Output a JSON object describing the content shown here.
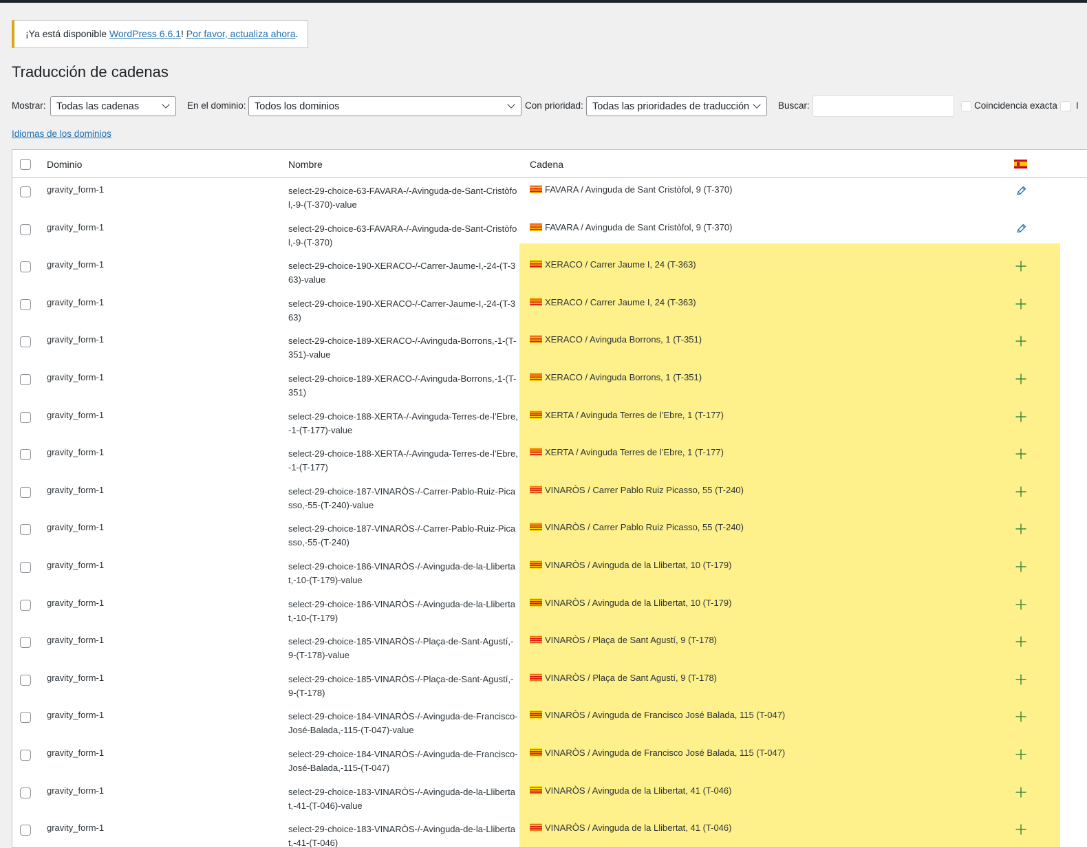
{
  "notice": {
    "prefix": "¡Ya está disponible ",
    "version_link": "WordPress 6.6.1",
    "middle": "! ",
    "update_link": "Por favor, actualiza ahora",
    "suffix": "."
  },
  "page_title": "Traducción de cadenas",
  "filters": {
    "show_label": "Mostrar:",
    "show_value": "Todas las cadenas",
    "domain_label": "En el dominio:",
    "domain_value": "Todos los dominios",
    "priority_label": "Con prioridad:",
    "priority_value": "Todas las prioridades de traducción",
    "search_label": "Buscar:",
    "search_value": "",
    "exact_match_label": "Coincidencia exacta",
    "cut_label": "I"
  },
  "domains_link": "Idiomas de los dominios",
  "table": {
    "columns": {
      "domain": "Dominio",
      "name": "Nombre",
      "string": "Cadena"
    },
    "lang_flag_icon": "spain-flag-icon",
    "highlight_color": "#fef08a",
    "rows": [
      {
        "domain": "gravity_form-1",
        "name": "select-29-choice-63-FAVARA-/-Avinguda-de-Sant-Cristòfol,-9-(T-370)-value",
        "string": "FAVARA / Avinguda de Sant Cristòfol, 9 (T-370)",
        "action": "edit"
      },
      {
        "domain": "gravity_form-1",
        "name": "select-29-choice-63-FAVARA-/-Avinguda-de-Sant-Cristòfol,-9-(T-370)",
        "string": "FAVARA / Avinguda de Sant Cristòfol, 9 (T-370)",
        "action": "edit"
      },
      {
        "domain": "gravity_form-1",
        "name": "select-29-choice-190-XERACO-/-Carrer-Jaume-I,-24-(T-363)-value",
        "string": "XERACO / Carrer Jaume I, 24 (T-363)",
        "action": "add"
      },
      {
        "domain": "gravity_form-1",
        "name": "select-29-choice-190-XERACO-/-Carrer-Jaume-I,-24-(T-363)",
        "string": "XERACO / Carrer Jaume I, 24 (T-363)",
        "action": "add"
      },
      {
        "domain": "gravity_form-1",
        "name": "select-29-choice-189-XERACO-/-Avinguda-Borrons,-1-(T-351)-value",
        "string": "XERACO / Avinguda Borrons, 1 (T-351)",
        "action": "add"
      },
      {
        "domain": "gravity_form-1",
        "name": "select-29-choice-189-XERACO-/-Avinguda-Borrons,-1-(T-351)",
        "string": "XERACO / Avinguda Borrons, 1 (T-351)",
        "action": "add"
      },
      {
        "domain": "gravity_form-1",
        "name": "select-29-choice-188-XERTA-/-Avinguda-Terres-de-l’Ebre,-1-(T-177)-value",
        "string": "XERTA / Avinguda Terres de l’Ebre, 1 (T-177)",
        "action": "add"
      },
      {
        "domain": "gravity_form-1",
        "name": "select-29-choice-188-XERTA-/-Avinguda-Terres-de-l’Ebre,-1-(T-177)",
        "string": "XERTA / Avinguda Terres de l’Ebre, 1 (T-177)",
        "action": "add"
      },
      {
        "domain": "gravity_form-1",
        "name": "select-29-choice-187-VINARÒS-/-Carrer-Pablo-Ruiz-Picasso,-55-(T-240)-value",
        "string": "VINARÒS / Carrer Pablo Ruiz Picasso, 55 (T-240)",
        "action": "add"
      },
      {
        "domain": "gravity_form-1",
        "name": "select-29-choice-187-VINARÒS-/-Carrer-Pablo-Ruiz-Picasso,-55-(T-240)",
        "string": "VINARÒS / Carrer Pablo Ruiz Picasso, 55 (T-240)",
        "action": "add"
      },
      {
        "domain": "gravity_form-1",
        "name": "select-29-choice-186-VINARÒS-/-Avinguda-de-la-Llibertat,-10-(T-179)-value",
        "string": "VINARÒS / Avinguda de la Llibertat, 10 (T-179)",
        "action": "add"
      },
      {
        "domain": "gravity_form-1",
        "name": "select-29-choice-186-VINARÒS-/-Avinguda-de-la-Llibertat,-10-(T-179)",
        "string": "VINARÒS / Avinguda de la Llibertat, 10 (T-179)",
        "action": "add"
      },
      {
        "domain": "gravity_form-1",
        "name": "select-29-choice-185-VINARÒS-/-Plaça-de-Sant-Agustí,-9-(T-178)-value",
        "string": "VINARÒS / Plaça de Sant Agustí, 9 (T-178)",
        "action": "add"
      },
      {
        "domain": "gravity_form-1",
        "name": "select-29-choice-185-VINARÒS-/-Plaça-de-Sant-Agustí,-9-(T-178)",
        "string": "VINARÒS / Plaça de Sant Agustí, 9 (T-178)",
        "action": "add"
      },
      {
        "domain": "gravity_form-1",
        "name": "select-29-choice-184-VINARÒS-/-Avinguda-de-Francisco-José-Balada,-115-(T-047)-value",
        "string": "VINARÒS / Avinguda de Francisco José Balada, 115 (T-047)",
        "action": "add"
      },
      {
        "domain": "gravity_form-1",
        "name": "select-29-choice-184-VINARÒS-/-Avinguda-de-Francisco-José-Balada,-115-(T-047)",
        "string": "VINARÒS / Avinguda de Francisco José Balada, 115 (T-047)",
        "action": "add"
      },
      {
        "domain": "gravity_form-1",
        "name": "select-29-choice-183-VINARÒS-/-Avinguda-de-la-Llibertat,-41-(T-046)-value",
        "string": "VINARÒS / Avinguda de la Llibertat, 41 (T-046)",
        "action": "add"
      },
      {
        "domain": "gravity_form-1",
        "name": "select-29-choice-183-VINARÒS-/-Avinguda-de-la-Llibertat,-41-(T-046)",
        "string": "VINARÒS / Avinguda de la Llibertat, 41 (T-046)",
        "action": "add"
      }
    ]
  }
}
